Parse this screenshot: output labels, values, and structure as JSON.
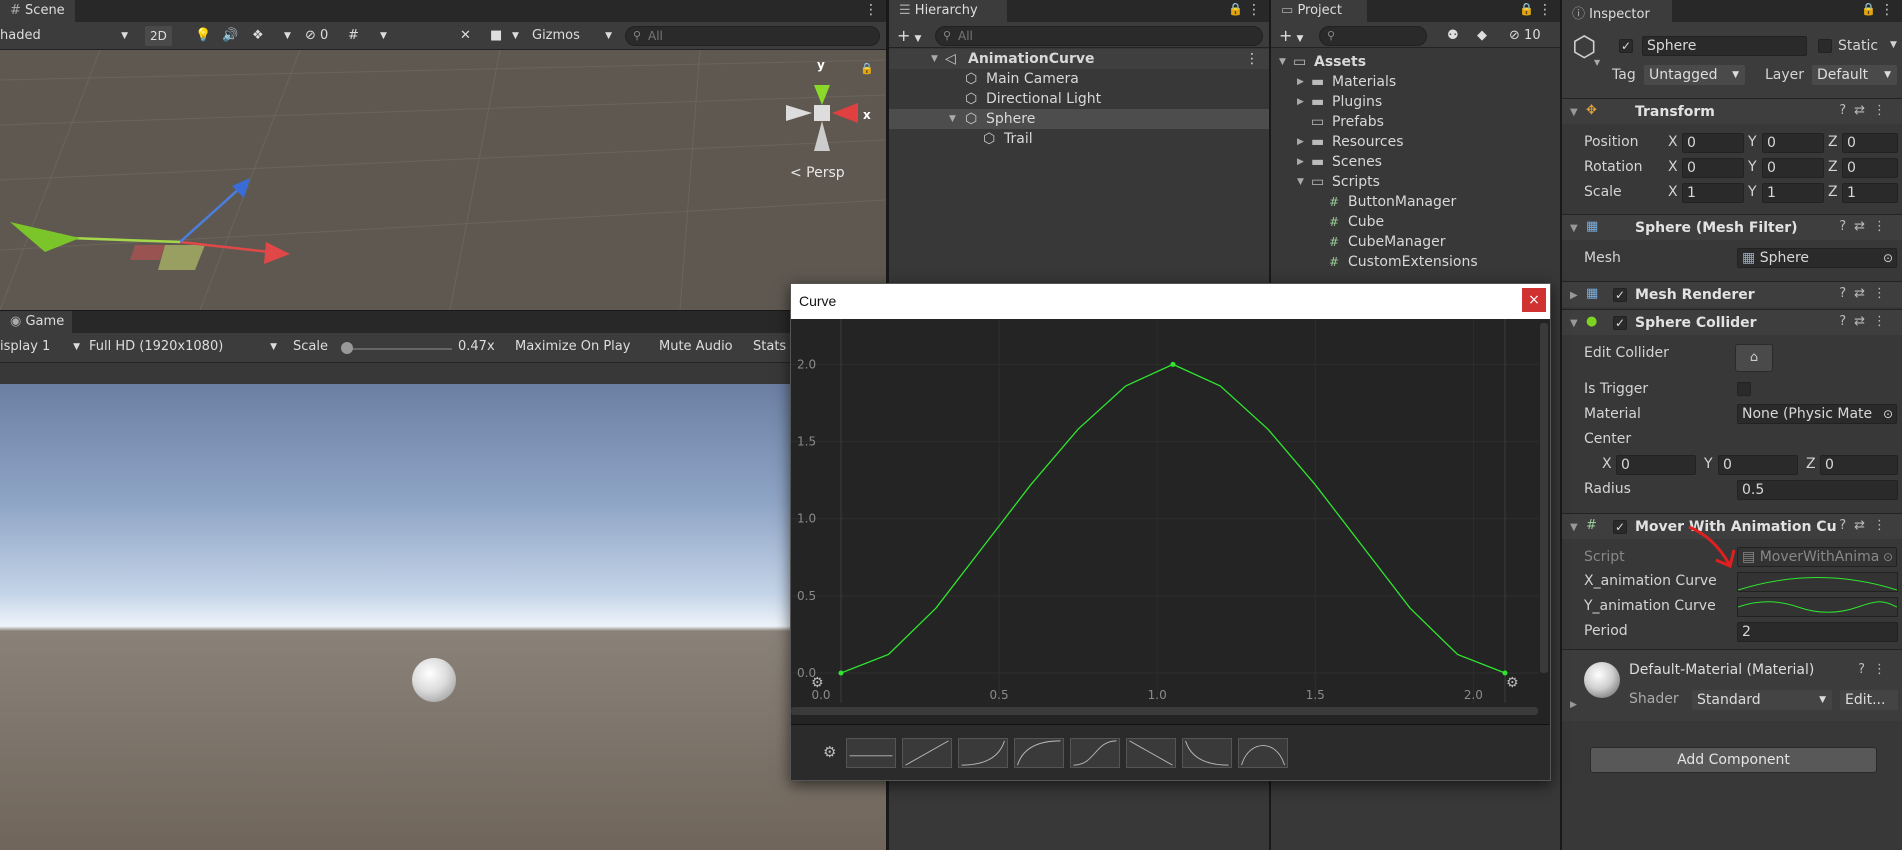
{
  "scene": {
    "tab_label": "Scene",
    "shading_mode": "haded",
    "btn_2d": "2D",
    "hidden_count": "0",
    "gizmos_label": "Gizmos",
    "search_placeholder": "All",
    "gizmo_y": "y",
    "gizmo_x": "x",
    "persp_label": "< Persp"
  },
  "game": {
    "tab_label": "Game",
    "display": "isplay 1",
    "resolution": "Full HD (1920x1080)",
    "scale_label": "Scale",
    "scale_value": "0.47x",
    "scale_fraction": 0.0,
    "maximize_label": "Maximize On Play",
    "mute_label": "Mute Audio",
    "stats_label": "Stats"
  },
  "hierarchy": {
    "tab_label": "Hierarchy",
    "search_placeholder": "All",
    "items": [
      {
        "label": "AnimationCurve"
      },
      {
        "label": "Main Camera"
      },
      {
        "label": "Directional Light"
      },
      {
        "label": "Sphere"
      },
      {
        "label": "Trail"
      }
    ]
  },
  "project": {
    "tab_label": "Project",
    "hidden_count": "10",
    "items": [
      {
        "label": "Assets"
      },
      {
        "label": "Materials"
      },
      {
        "label": "Plugins"
      },
      {
        "label": "Prefabs"
      },
      {
        "label": "Resources"
      },
      {
        "label": "Scenes"
      },
      {
        "label": "Scripts"
      },
      {
        "label": "ButtonManager"
      },
      {
        "label": "Cube"
      },
      {
        "label": "CubeManager"
      },
      {
        "label": "CustomExtensions"
      }
    ]
  },
  "inspector": {
    "tab_label": "Inspector",
    "object_name": "Sphere",
    "static_label": "Static",
    "tag_label": "Tag",
    "tag_value": "Untagged",
    "layer_label": "Layer",
    "layer_value": "Default",
    "transform": {
      "title": "Transform",
      "position_label": "Position",
      "rotation_label": "Rotation",
      "scale_label": "Scale",
      "axis_x": "X",
      "axis_y": "Y",
      "axis_z": "Z",
      "position": [
        "0",
        "0",
        "0"
      ],
      "rotation": [
        "0",
        "0",
        "0"
      ],
      "scale": [
        "1",
        "1",
        "1"
      ]
    },
    "mesh_filter": {
      "title": "Sphere (Mesh Filter)",
      "mesh_label": "Mesh",
      "mesh_value": "Sphere"
    },
    "mesh_renderer": {
      "title": "Mesh Renderer"
    },
    "collider": {
      "title": "Sphere Collider",
      "edit_label": "Edit Collider",
      "trigger_label": "Is Trigger",
      "material_label": "Material",
      "material_value": "None (Physic Mate",
      "center_label": "Center",
      "center": [
        "0",
        "0",
        "0"
      ],
      "radius_label": "Radius",
      "radius_value": "0.5"
    },
    "mover": {
      "title": "Mover With Animation Cu",
      "script_label": "Script",
      "script_value": "MoverWithAnima",
      "x_curve_label": "X_animation Curve",
      "y_curve_label": "Y_animation Curve",
      "period_label": "Period",
      "period_value": "2"
    },
    "material": {
      "title": "Default-Material (Material)",
      "shader_label": "Shader",
      "shader_value": "Standard",
      "edit_label": "Edit..."
    },
    "add_component": "Add Component"
  },
  "curve_window": {
    "title": "Curve",
    "close": "×",
    "accent": "#2ee62e"
  },
  "chart_data": {
    "type": "line",
    "title": "Curve",
    "xlim": [
      0,
      2.1
    ],
    "ylim": [
      0,
      2.1
    ],
    "x_ticks": [
      "0.0",
      "0.5",
      "1.0",
      "1.5",
      "2.0"
    ],
    "y_ticks": [
      "0.0",
      "0.5",
      "1.0",
      "1.5",
      "2.0"
    ],
    "keys": [
      {
        "x": 0,
        "y": 0
      },
      {
        "x": 1.05,
        "y": 2.0
      },
      {
        "x": 2.1,
        "y": 0
      }
    ],
    "series": [
      {
        "x": [
          0,
          0.15,
          0.3,
          0.45,
          0.6,
          0.75,
          0.9,
          1.05,
          1.2,
          1.35,
          1.5,
          1.65,
          1.8,
          1.95,
          2.1
        ],
        "y": [
          0,
          0.12,
          0.42,
          0.82,
          1.22,
          1.58,
          1.86,
          2.0,
          1.86,
          1.58,
          1.22,
          0.82,
          0.42,
          0.12,
          0
        ]
      }
    ]
  }
}
